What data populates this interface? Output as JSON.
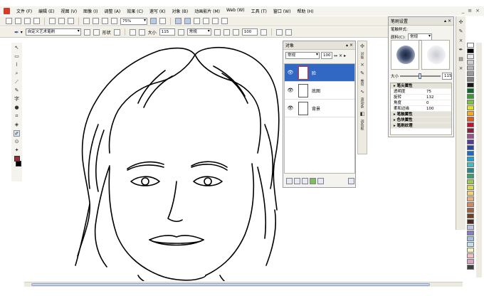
{
  "window": {
    "controls": [
      "_",
      "≡",
      "×"
    ]
  },
  "menu": [
    "文件 (F)",
    "编辑 (E)",
    "视图 (V)",
    "图像 (I)",
    "调整 (A)",
    "效果 (C)",
    "速写 (K)",
    "对象 (B)",
    "动画影片 (M)",
    "Web (W)",
    "工具 (T)",
    "窗口 (W)",
    "帮助 (H)"
  ],
  "toolbar": {
    "zoom": "75%"
  },
  "property_bar": {
    "brush_name": "自定义艺术笔刷",
    "shape_label": "形状",
    "size_label": "大小",
    "size_value": "115",
    "mode": "常规",
    "opacity_value": "100"
  },
  "layers_panel": {
    "title": "对象",
    "blend_mode": "常规",
    "opacity": "100",
    "layers": [
      {
        "name": "脸",
        "selected": true
      },
      {
        "name": "底图",
        "selected": false
      },
      {
        "name": "背景",
        "selected": false
      }
    ]
  },
  "side_tabs": [
    "对象",
    "卷帘",
    "滚动条",
    "调色板",
    "笔刷设置"
  ],
  "brush_settings": {
    "title": "笔刷设置",
    "style_label": "笔触样式:",
    "color_label": "颜料(C):",
    "color_value": "常规",
    "size_label": "大小",
    "size_value": "115",
    "size_level": 0.45,
    "props": [
      {
        "name": "笔尖属性",
        "value": "",
        "header": true
      },
      {
        "name": "透明度",
        "value": "75"
      },
      {
        "name": "旋转",
        "value": "132"
      },
      {
        "name": "角度",
        "value": "0"
      },
      {
        "name": "柔和边缘",
        "value": "100"
      },
      {
        "name": "笔触属性",
        "value": "",
        "header": true
      },
      {
        "name": "色块属性",
        "value": "",
        "header": true
      },
      {
        "name": "笔刷纹理",
        "value": "",
        "header": true
      }
    ]
  },
  "colors": {
    "fg": "#a02838",
    "bg": "#000000",
    "palette": [
      "#ffffff",
      "#000000",
      "#e6e6e6",
      "#cccccc",
      "#b3b3b3",
      "#999999",
      "#808080",
      "#1a1a1a",
      "#0a6a2a",
      "#3a9a3a",
      "#7ac143",
      "#e0e020",
      "#f7a620",
      "#e05a1a",
      "#c8102e",
      "#8a1e3c",
      "#a0508c",
      "#5a3a9a",
      "#2a4aa0",
      "#1a6ac8",
      "#20a0d8",
      "#40c0c0",
      "#208a8a",
      "#3aa070",
      "#9ac850",
      "#d8d850",
      "#f0d070",
      "#e8b080",
      "#d08860",
      "#a06040",
      "#704020",
      "#4a2a1a",
      "#c0c0e0",
      "#8080c0",
      "#a0c0e0",
      "#c0e0f0",
      "#f0f0c0",
      "#f0c0c0",
      "#e0a0c0",
      "#404040"
    ]
  }
}
